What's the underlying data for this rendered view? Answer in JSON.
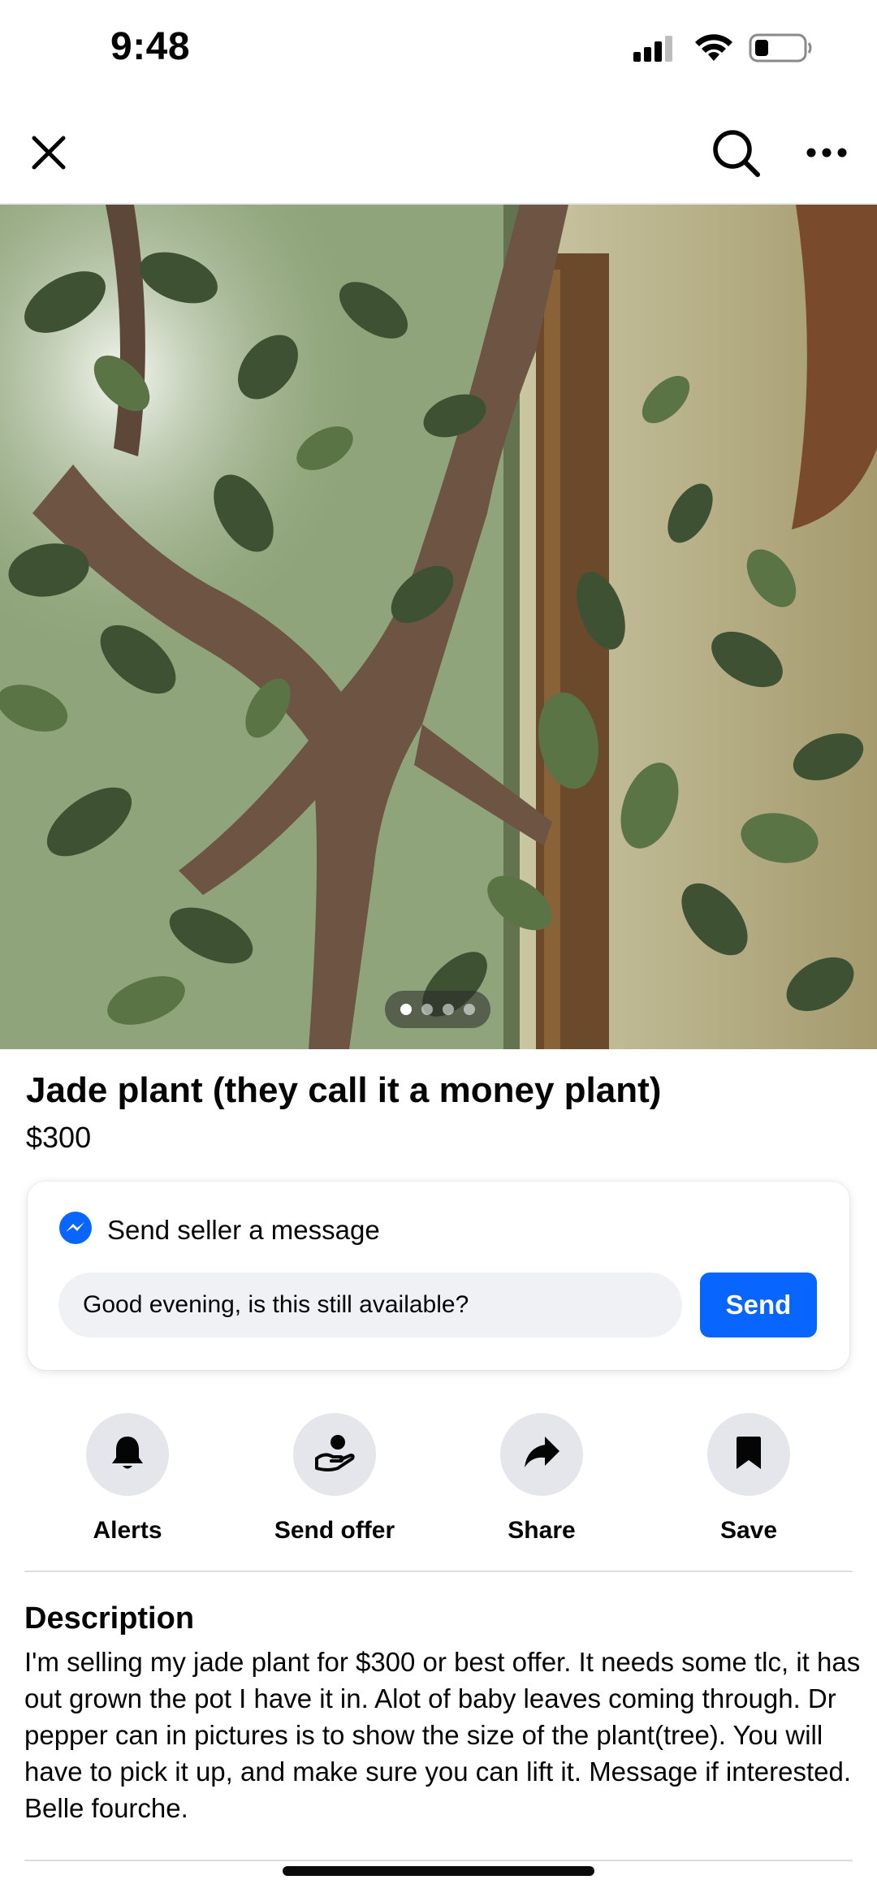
{
  "status_bar": {
    "time": "9:48",
    "icons": [
      "cellular-signal-icon",
      "wifi-icon",
      "battery-icon"
    ]
  },
  "nav": {
    "icons": [
      "close-icon",
      "search-icon",
      "more-options-icon"
    ]
  },
  "gallery": {
    "photo_subject": "jade plant photo",
    "page_count": 4,
    "active_page": 1
  },
  "listing": {
    "title": "Jade plant (they call it a money plant)",
    "price": "$300"
  },
  "message": {
    "heading": "Send seller a message",
    "input_value": "Good evening, is this still available?",
    "send_label": "Send",
    "icon": "messenger-icon"
  },
  "actions": [
    {
      "label": "Alerts",
      "icon": "bell-icon"
    },
    {
      "label": "Send offer",
      "icon": "offer-icon"
    },
    {
      "label": "Share",
      "icon": "share-arrow-icon"
    },
    {
      "label": "Save",
      "icon": "bookmark-icon"
    }
  ],
  "description": {
    "heading": "Description",
    "body": "I'm selling my jade plant for $300 or best offer. It needs some tlc, it has out grown the pot I have it in. Alot of baby leaves coming through. Dr pepper can in pictures is to show the size of the plant(tree). You will have to pick it up, and make sure you can lift it.  Message if interested. Belle fourche."
  },
  "colors": {
    "accent": "#0866ff",
    "action_circle": "#e4e6eb",
    "input_bg": "#eff1f4"
  }
}
